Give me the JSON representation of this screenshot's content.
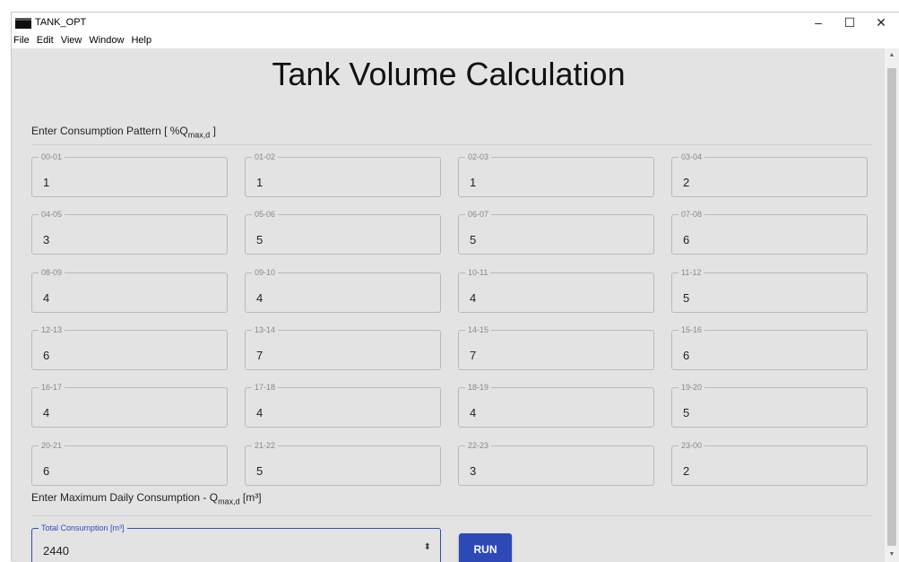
{
  "window": {
    "title": "TANK_OPT",
    "minimize": "–",
    "maximize": "☐",
    "close": "✕"
  },
  "menu": [
    "File",
    "Edit",
    "View",
    "Window",
    "Help"
  ],
  "page_title": "Tank Volume Calculation",
  "consumption_pattern": {
    "label_prefix": "Enter Consumption Pattern [ %Q",
    "label_sub": "max,d",
    "label_suffix": " ]",
    "fields": [
      {
        "label": "00-01",
        "value": "1"
      },
      {
        "label": "01-02",
        "value": "1"
      },
      {
        "label": "02-03",
        "value": "1"
      },
      {
        "label": "03-04",
        "value": "2"
      },
      {
        "label": "04-05",
        "value": "3"
      },
      {
        "label": "05-06",
        "value": "5"
      },
      {
        "label": "06-07",
        "value": "5"
      },
      {
        "label": "07-08",
        "value": "6"
      },
      {
        "label": "08-09",
        "value": "4"
      },
      {
        "label": "09-10",
        "value": "4"
      },
      {
        "label": "10-11",
        "value": "4"
      },
      {
        "label": "11-12",
        "value": "5"
      },
      {
        "label": "12-13",
        "value": "6"
      },
      {
        "label": "13-14",
        "value": "7"
      },
      {
        "label": "14-15",
        "value": "7"
      },
      {
        "label": "15-16",
        "value": "6"
      },
      {
        "label": "16-17",
        "value": "4"
      },
      {
        "label": "17-18",
        "value": "4"
      },
      {
        "label": "18-19",
        "value": "4"
      },
      {
        "label": "19-20",
        "value": "5"
      },
      {
        "label": "20-21",
        "value": "6"
      },
      {
        "label": "21-22",
        "value": "5"
      },
      {
        "label": "22-23",
        "value": "3"
      },
      {
        "label": "23-00",
        "value": "2"
      }
    ]
  },
  "max_daily": {
    "label_prefix": "Enter Maximum Daily Consumption - Q",
    "label_sub": "max,d",
    "label_suffix": " [m³]",
    "field_label": "Total Consumption [m³]",
    "value": "2440",
    "stepper_icon": "⬍"
  },
  "run_label": "RUN",
  "scroll": {
    "up": "▲",
    "down": "▼"
  }
}
